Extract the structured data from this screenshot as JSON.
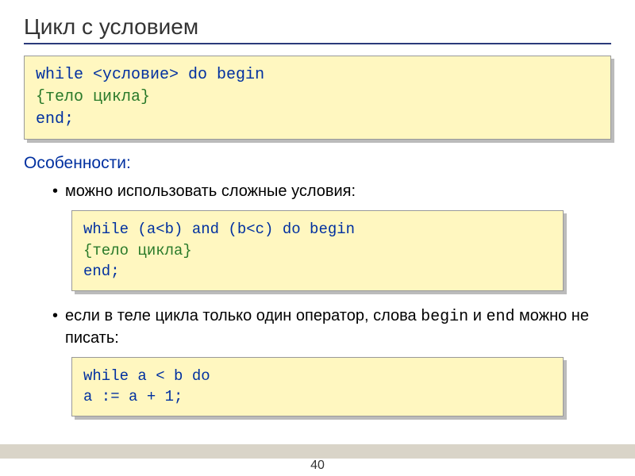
{
  "title": "Цикл с условием",
  "syntax_box": {
    "line1_prefix": "   while ",
    "line1_cond": "<условие>",
    "line1_suffix": " do begin",
    "line2": "  {тело цикла}",
    "line3": " end;"
  },
  "features_label": "Особенности:",
  "bullet1": "можно использовать сложные условия:",
  "example1": {
    "line1": "while (a<b) and (b<c) do begin",
    "line2": "  {тело цикла}",
    "line3": "end;"
  },
  "bullet2_prefix": "если в теле цикла только один оператор, слова ",
  "bullet2_mono1": "begin",
  "bullet2_mid": " и ",
  "bullet2_mono2": "end",
  "bullet2_suffix": " можно не писать:",
  "example2": {
    "line1": "while a < b do",
    "line2": "   a := a + 1;"
  },
  "slide_number": "40"
}
